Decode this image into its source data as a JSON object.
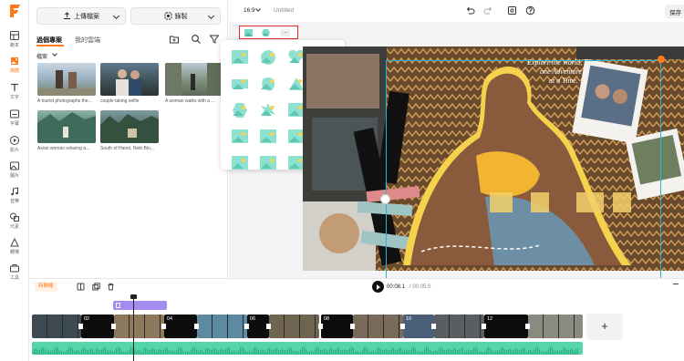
{
  "colors": {
    "accent": "#ff7a1a",
    "selection_red": "#e0262a",
    "guide": "#29b5d1",
    "audio": "#55d6a8",
    "text_clip": "#a48cf0"
  },
  "rail": {
    "items": [
      {
        "label": "範本",
        "icon": "template-icon"
      },
      {
        "label": "媒體",
        "icon": "media-icon"
      },
      {
        "label": "文字",
        "icon": "text-icon"
      },
      {
        "label": "字幕",
        "icon": "subtitle-icon"
      },
      {
        "label": "影片",
        "icon": "video-icon"
      },
      {
        "label": "圖片",
        "icon": "image-icon"
      },
      {
        "label": "音樂",
        "icon": "music-icon"
      },
      {
        "label": "元素",
        "icon": "elements-icon"
      },
      {
        "label": "轉場",
        "icon": "transition-icon"
      },
      {
        "label": "工具",
        "icon": "tools-icon"
      }
    ]
  },
  "panel": {
    "upload_label": "上傳檔案",
    "record_label": "錄製",
    "tab_recent": "過個專案",
    "tab_mine": "我的雲端",
    "filter_label": "檔案",
    "thumbs": [
      {
        "caption": "A tourist photographs the..."
      },
      {
        "caption": "couple taking selfie"
      },
      {
        "caption": "A woman walks with a ..."
      },
      {
        "caption": "Asian woman relaxing a..."
      },
      {
        "caption": "South of Hanoi, Ninh Bin..."
      }
    ]
  },
  "topbar": {
    "ratio": "16:9",
    "title": "Untitled",
    "save_label": "保存"
  },
  "canvas": {
    "headline_1": "Explore the World,",
    "headline_2": "one Adventure",
    "headline_3": "at a Time."
  },
  "timeline": {
    "mode_label": "時間線",
    "current_time": "00:08.1",
    "total_time": "/ 00:05.0",
    "clip_numbers": [
      "02",
      "04",
      "06",
      "08",
      "10",
      "12"
    ],
    "add_label": "+"
  }
}
